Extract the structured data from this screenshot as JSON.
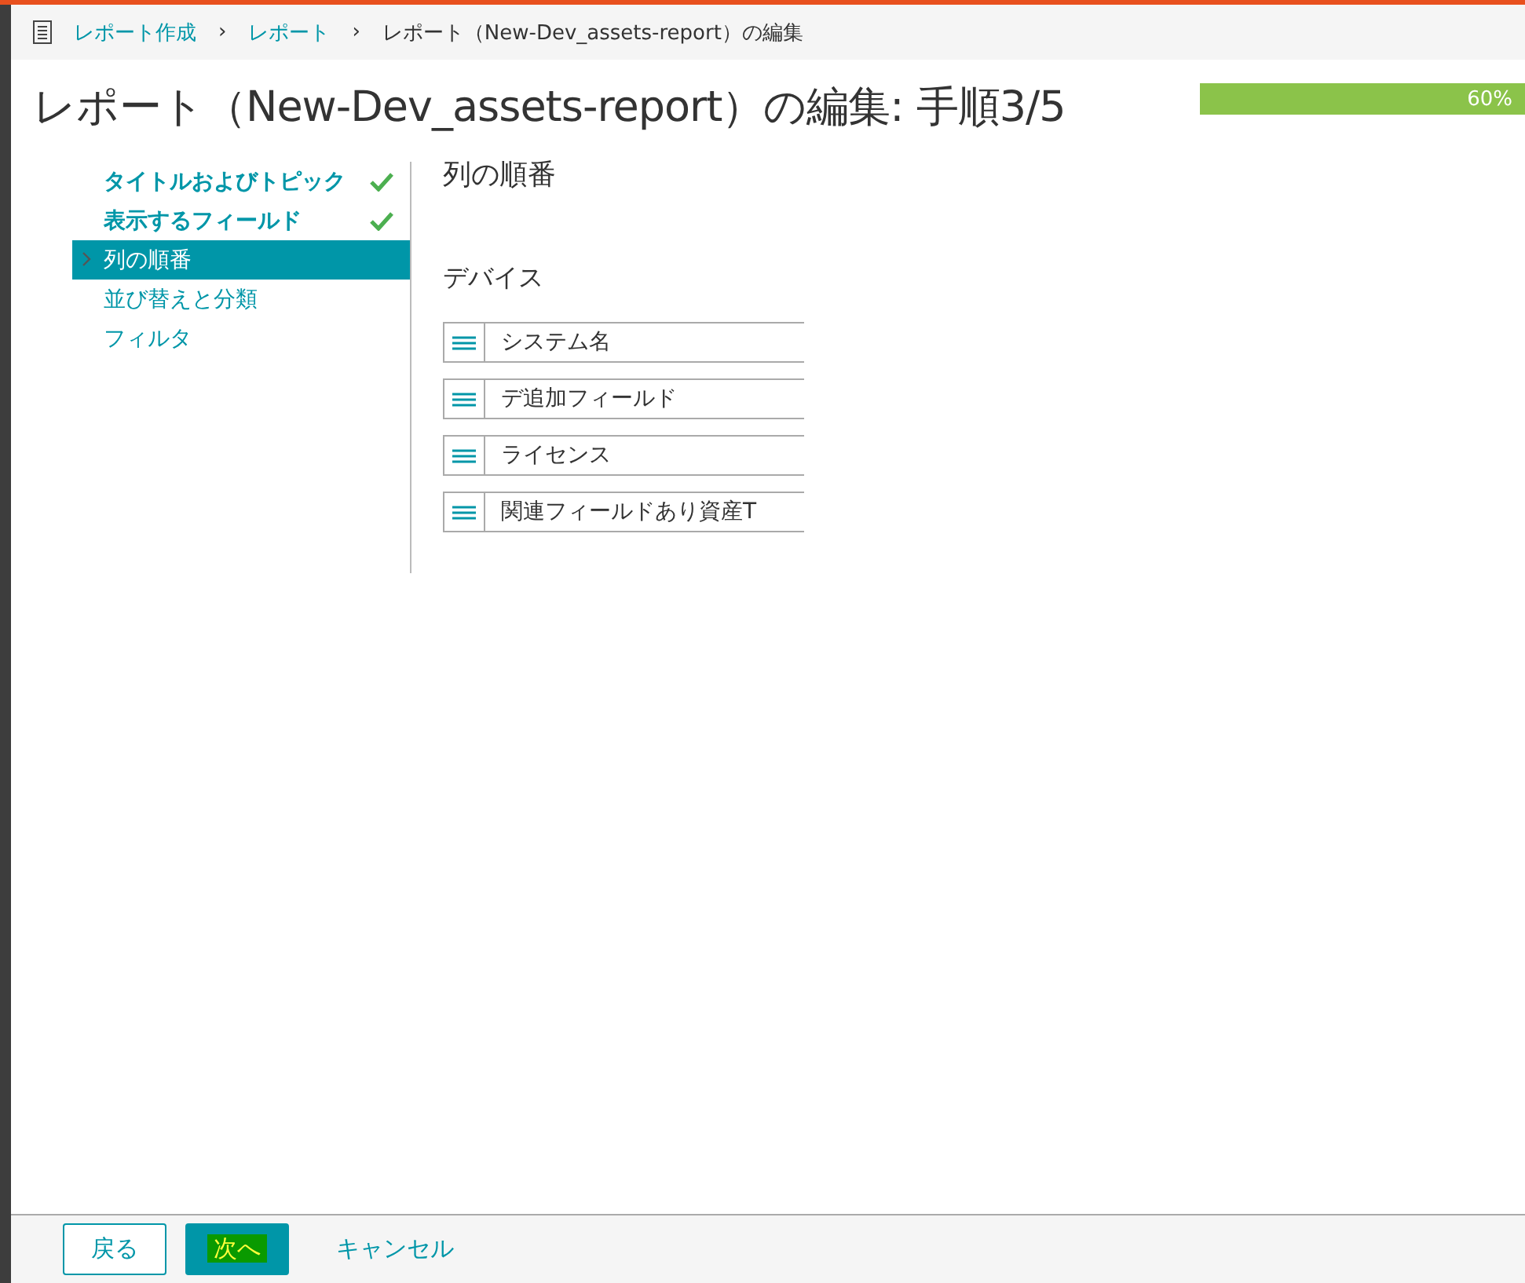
{
  "breadcrumb": [
    {
      "label": "レポート作成",
      "link": true
    },
    {
      "label": "レポート",
      "link": true
    },
    {
      "label": "レポート（New-Dev_assets-report）の編集",
      "link": false
    }
  ],
  "separator": "›",
  "title": "レポート（New-Dev_assets-report）の編集: 手順3/5",
  "progress": {
    "level": 0.6,
    "reading": "60%"
  },
  "steps": [
    {
      "label": "タイトルおよびトピック",
      "completed": true,
      "selected": false
    },
    {
      "label": "表示するフィールド",
      "completed": true,
      "selected": false
    },
    {
      "label": "列の順番",
      "completed": false,
      "selected": true
    },
    {
      "label": "並び替えと分類",
      "completed": false,
      "selected": false
    },
    {
      "label": "フィルタ",
      "completed": false,
      "selected": false
    }
  ],
  "section_title": "列の順番",
  "group_title": "デバイス",
  "columns": [
    "システム名",
    "デ追加フィールド",
    "ライセンス",
    "関連フィールドあり資産T"
  ],
  "footer": {
    "back": "戻る",
    "next": "次へ",
    "cancel": "キャンセル"
  }
}
